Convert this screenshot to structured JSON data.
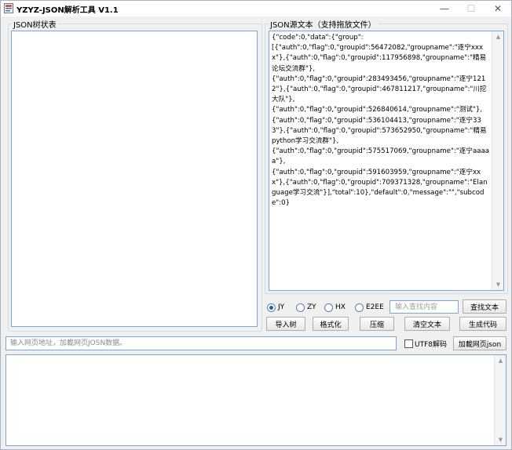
{
  "window": {
    "title": "YZYZ-JSON解析工具 V1.1",
    "min_glyph": "—",
    "max_glyph": "☐",
    "close_glyph": "✕"
  },
  "tree_panel": {
    "legend": "JSON树状表"
  },
  "source_panel": {
    "legend": "JSON源文本（支持拖放文件）",
    "text": "{\"code\":0,\"data\":{\"group\":\n[{\"auth\":0,\"flag\":0,\"groupid\":56472082,\"groupname\":\"逐宁xxxx\"},{\"auth\":0,\"flag\":0,\"groupid\":117956898,\"groupname\":\"精易论坛交流群\"},\n{\"auth\":0,\"flag\":0,\"groupid\":283493456,\"groupname\":\"逐宁1212\"},{\"auth\":0,\"flag\":0,\"groupid\":467811217,\"groupname\":\"川挖大队\"},\n{\"auth\":0,\"flag\":0,\"groupid\":526840614,\"groupname\":\"测试\"},\n{\"auth\":0,\"flag\":0,\"groupid\":536104413,\"groupname\":\"逐宁333\"},{\"auth\":0,\"flag\":0,\"groupid\":573652950,\"groupname\":\"精易python学习交流群\"},\n{\"auth\":0,\"flag\":0,\"groupid\":575517069,\"groupname\":\"逐宁aaaaa\"},\n{\"auth\":0,\"flag\":0,\"groupid\":591603959,\"groupname\":\"逐宁xxx\"},{\"auth\":0,\"flag\":0,\"groupid\":709371328,\"groupname\":\"Elanguage学习交流\"}],\"total\":10},\"default\":0,\"message\":\"\",\"subcode\":0}"
  },
  "mode_radios": [
    {
      "label": "JY",
      "checked": true
    },
    {
      "label": "ZY",
      "checked": false
    },
    {
      "label": "HX",
      "checked": false
    },
    {
      "label": "E2EE",
      "checked": false
    }
  ],
  "search": {
    "placeholder": "输入查找内容",
    "button_label": "查找文本"
  },
  "actions": {
    "import_tree": "导入树",
    "format": "格式化",
    "compress": "压缩",
    "clear_text": "清空文本",
    "generate_code": "生成代码"
  },
  "url_bar": {
    "placeholder": "输入网页地址，加載网页JOSN数据。",
    "utf8_label": "UTF8解码",
    "utf8_checked": false,
    "load_button": "加載网页json"
  },
  "icons": {
    "app": "app-logo-icon",
    "scroll_up": "scroll-up-arrow-icon",
    "scroll_down": "scroll-down-arrow-icon"
  }
}
